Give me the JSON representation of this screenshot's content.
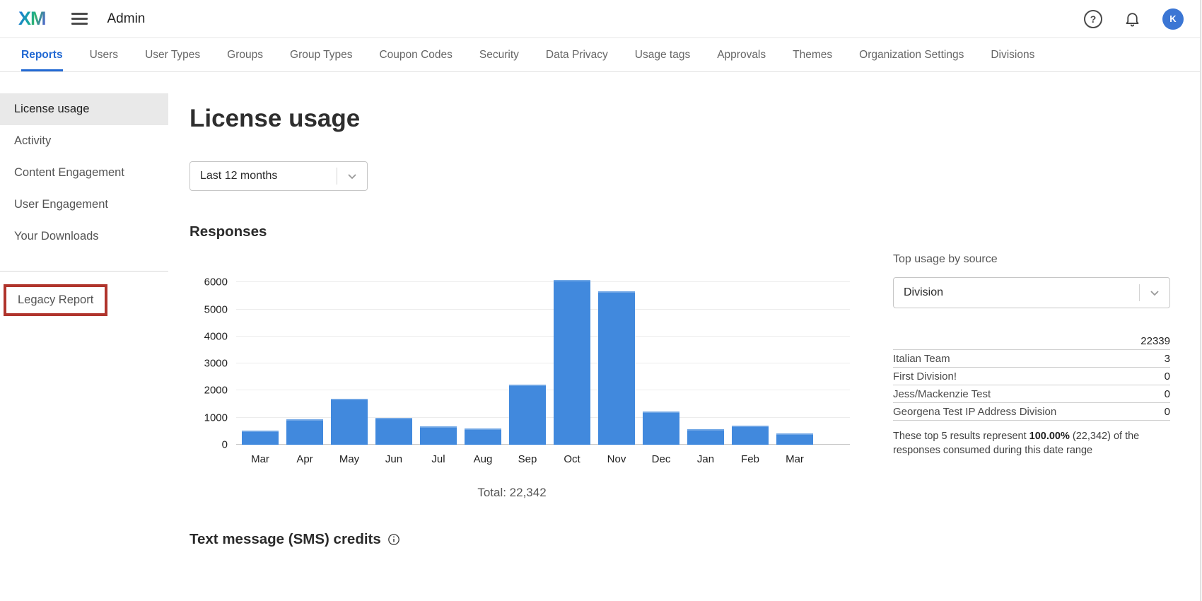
{
  "topbar": {
    "logo_text": "XM",
    "app_title": "Admin",
    "help_glyph": "?",
    "avatar_initial": "K"
  },
  "tabs": {
    "active_index": 0,
    "items": [
      "Reports",
      "Users",
      "User Types",
      "Groups",
      "Group Types",
      "Coupon Codes",
      "Security",
      "Data Privacy",
      "Usage tags",
      "Approvals",
      "Themes",
      "Organization Settings",
      "Divisions"
    ]
  },
  "sidebar": {
    "selected_index": 0,
    "items": [
      "License usage",
      "Activity",
      "Content Engagement",
      "User Engagement",
      "Your Downloads"
    ],
    "legacy_item": "Legacy Report"
  },
  "main": {
    "page_title": "License usage",
    "date_range_value": "Last 12 months",
    "responses_title": "Responses",
    "total_text": "Total: 22,342",
    "sms_title": "Text message (SMS) credits"
  },
  "chart_data": {
    "type": "bar",
    "title": "Responses",
    "categories": [
      "Mar",
      "Apr",
      "May",
      "Jun",
      "Jul",
      "Aug",
      "Sep",
      "Oct",
      "Nov",
      "Dec",
      "Jan",
      "Feb",
      "Mar"
    ],
    "values": [
      520,
      950,
      1690,
      990,
      690,
      590,
      2230,
      6090,
      5672,
      1230,
      580,
      700,
      410
    ],
    "total": 22342,
    "xlabel": "",
    "ylabel": "",
    "yticks": [
      0,
      1000,
      2000,
      3000,
      4000,
      5000,
      6000
    ],
    "ylim": [
      0,
      6400
    ],
    "grid": true,
    "legend": false,
    "bar_color": "#4189dd"
  },
  "top_usage": {
    "title": "Top usage by source",
    "dropdown_value": "Division",
    "rows": [
      {
        "label": "",
        "value": "22339"
      },
      {
        "label": "Italian Team",
        "value": "3"
      },
      {
        "label": "First Division!",
        "value": "0"
      },
      {
        "label": "Jess/Mackenzie Test",
        "value": "0"
      },
      {
        "label": "Georgena Test IP Address Division",
        "value": "0"
      }
    ],
    "footnote": {
      "prefix": "These top 5 results represent ",
      "bold": "100.00%",
      "suffix": " (22,342) of the responses consumed during this date range"
    }
  },
  "colors": {
    "accent_blue": "#2269d3",
    "bar_blue": "#4189dd",
    "annotation_red": "#b0342c",
    "avatar_blue": "#3b76d4"
  }
}
